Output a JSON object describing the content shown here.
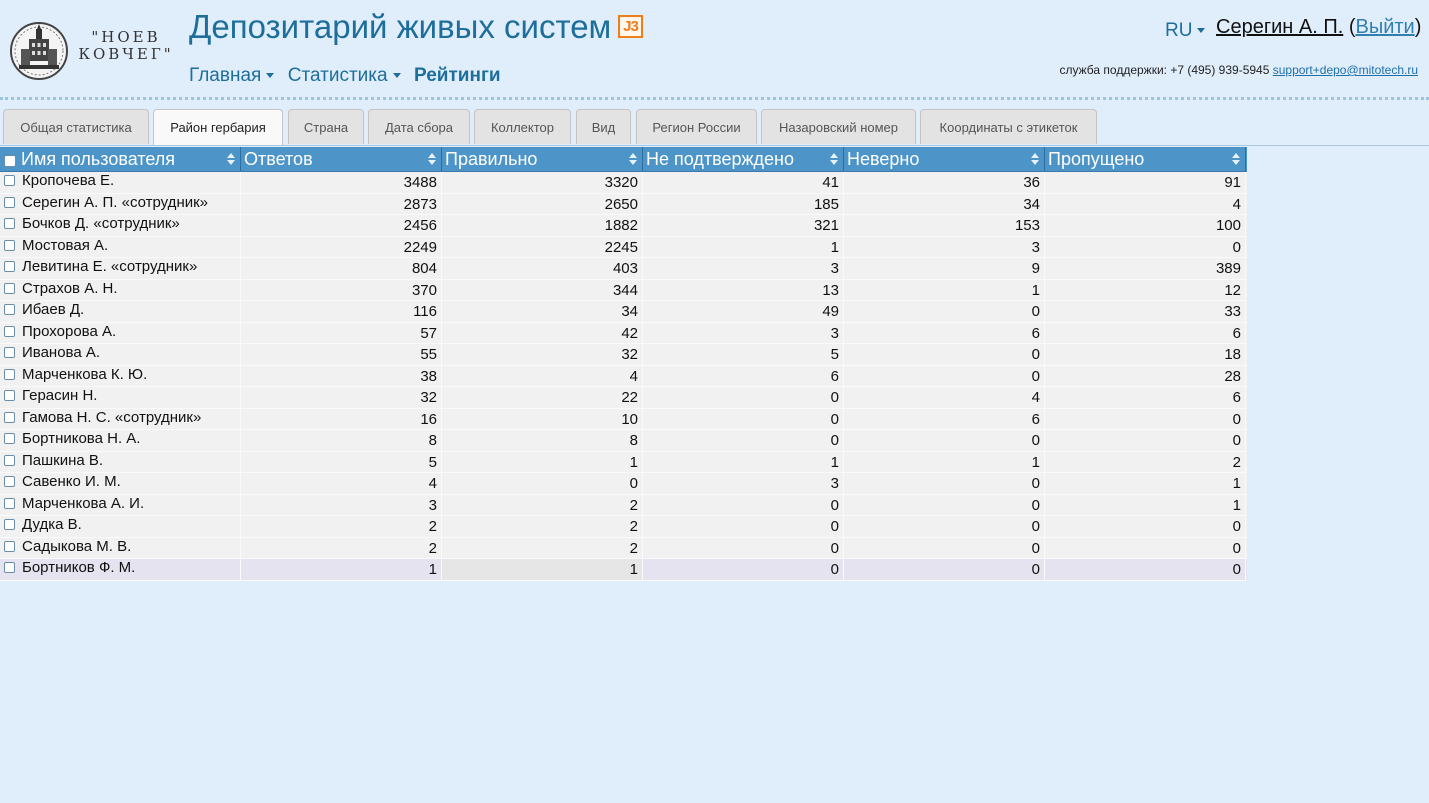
{
  "header": {
    "logo_line1": "\"НОЕВ",
    "logo_line2": "КОВЧЕГ\"",
    "title": "Депозитарий живых систем",
    "badge": "J3",
    "nav": [
      {
        "label": "Главная",
        "dropdown": true
      },
      {
        "label": "Статистика",
        "dropdown": true
      },
      {
        "label": "Рейтинги",
        "dropdown": false,
        "active": true
      }
    ],
    "lang": "RU",
    "user_name": "Серегин А. П.",
    "logout_label": "Выйти",
    "support_text": "служба поддержки: +7 (495) 939-5945",
    "support_email": "support+depo@mitotech.ru"
  },
  "tabs": [
    {
      "label": "Общая статистика"
    },
    {
      "label": "Район гербария",
      "active": true
    },
    {
      "label": "Страна"
    },
    {
      "label": "Дата сбора"
    },
    {
      "label": "Коллектор"
    },
    {
      "label": "Вид"
    },
    {
      "label": "Регион России"
    },
    {
      "label": "Назаровский номер"
    },
    {
      "label": "Координаты с этикеток"
    }
  ],
  "table": {
    "columns": [
      "Имя пользователя",
      "Ответов",
      "Правильно",
      "Не подтверждено",
      "Неверно",
      "Пропущено"
    ],
    "rows": [
      [
        "Кропочева Е.",
        "3488",
        "3320",
        "41",
        "36",
        "91"
      ],
      [
        "Серегин А. П. «сотрудник»",
        "2873",
        "2650",
        "185",
        "34",
        "4"
      ],
      [
        "Бочков Д. «сотрудник»",
        "2456",
        "1882",
        "321",
        "153",
        "100"
      ],
      [
        "Мостовая А.",
        "2249",
        "2245",
        "1",
        "3",
        "0"
      ],
      [
        "Левитина Е. «сотрудник»",
        "804",
        "403",
        "3",
        "9",
        "389"
      ],
      [
        "Страхов А. Н.",
        "370",
        "344",
        "13",
        "1",
        "12"
      ],
      [
        "Ибаев Д.",
        "116",
        "34",
        "49",
        "0",
        "33"
      ],
      [
        "Прохорова А.",
        "57",
        "42",
        "3",
        "6",
        "6"
      ],
      [
        "Иванова А.",
        "55",
        "32",
        "5",
        "0",
        "18"
      ],
      [
        "Марченкова К. Ю.",
        "38",
        "4",
        "6",
        "0",
        "28"
      ],
      [
        "Герасин Н.",
        "32",
        "22",
        "0",
        "4",
        "6"
      ],
      [
        "Гамова Н. С. «сотрудник»",
        "16",
        "10",
        "0",
        "6",
        "0"
      ],
      [
        "Бортникова Н. А.",
        "8",
        "8",
        "0",
        "0",
        "0"
      ],
      [
        "Пашкина В.",
        "5",
        "1",
        "1",
        "1",
        "2"
      ],
      [
        "Савенко И. М.",
        "4",
        "0",
        "3",
        "0",
        "1"
      ],
      [
        "Марченкова А. И.",
        "3",
        "2",
        "0",
        "0",
        "1"
      ],
      [
        "Дудка В.",
        "2",
        "2",
        "0",
        "0",
        "0"
      ],
      [
        "Садыкова М. В.",
        "2",
        "2",
        "0",
        "0",
        "0"
      ],
      [
        "Бортников Ф. М.",
        "1",
        "1",
        "0",
        "0",
        "0"
      ]
    ],
    "selected_row": 18
  },
  "colors": {
    "page_bg": "#e0eefc",
    "brand_blue": "#1d6e9b",
    "header_blue": "#4d94c9",
    "badge_orange": "#ef7d1a"
  }
}
